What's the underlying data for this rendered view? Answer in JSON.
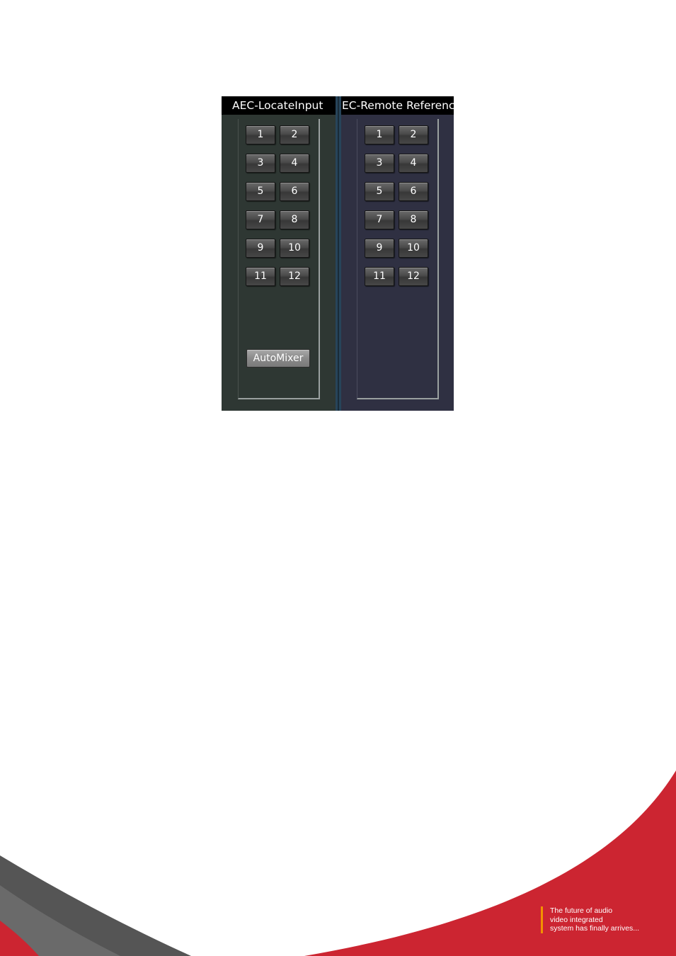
{
  "left_panel": {
    "title": "AEC-LocateInput",
    "buttons": [
      "1",
      "2",
      "3",
      "4",
      "5",
      "6",
      "7",
      "8",
      "9",
      "10",
      "11",
      "12"
    ],
    "automixer_label": "AutoMixer"
  },
  "right_panel": {
    "title": "EC-Remote Reference",
    "buttons": [
      "1",
      "2",
      "3",
      "4",
      "5",
      "6",
      "7",
      "8",
      "9",
      "10",
      "11",
      "12"
    ]
  },
  "footer": {
    "tagline": [
      "The future of audio",
      "video integrated",
      "system has finally arrives..."
    ]
  },
  "colors": {
    "left_panel_bg": "#2e3733",
    "right_panel_bg": "#2f3042",
    "brand_red": "#cc2531",
    "swoosh_gray": "#555555",
    "accent_orange": "#f29200"
  }
}
